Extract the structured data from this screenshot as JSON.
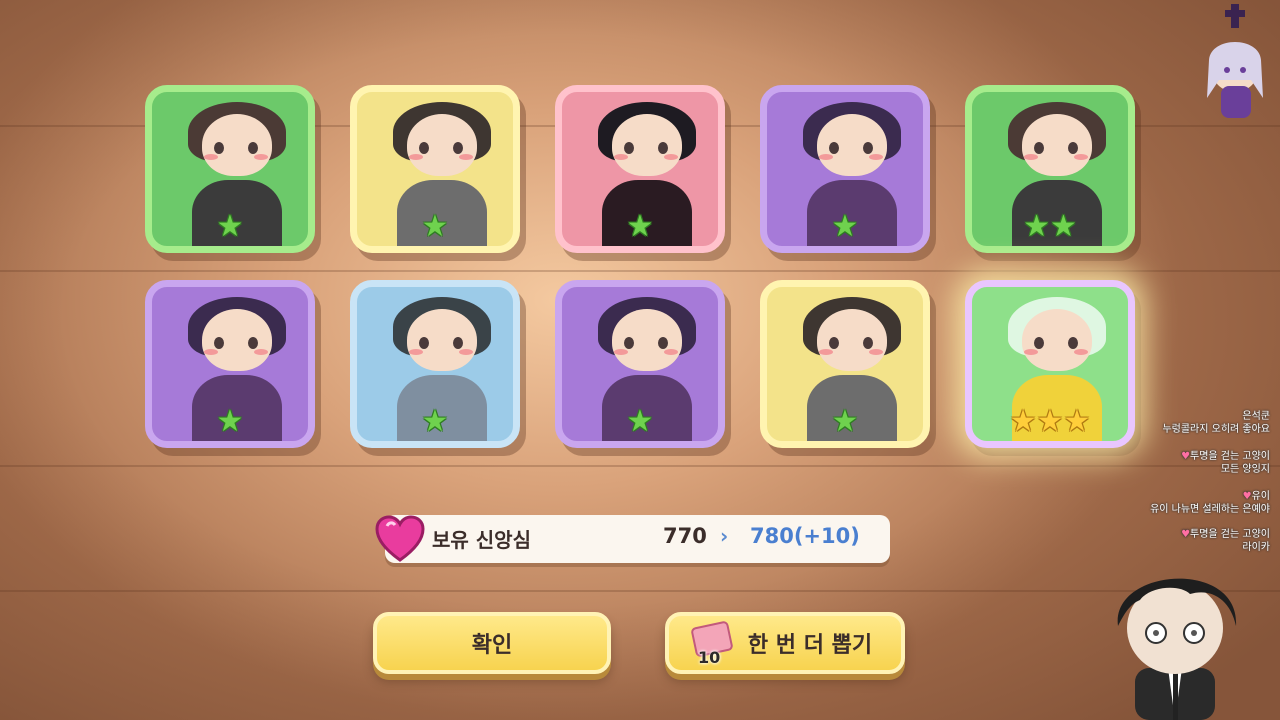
{
  "characters": [
    {
      "color": "green",
      "stars": 1
    },
    {
      "color": "yellow",
      "stars": 1
    },
    {
      "color": "pink",
      "stars": 1
    },
    {
      "color": "purple",
      "stars": 1
    },
    {
      "color": "green",
      "stars": 2
    },
    {
      "color": "purple",
      "stars": 1
    },
    {
      "color": "blue",
      "stars": 1
    },
    {
      "color": "purple",
      "stars": 1
    },
    {
      "color": "yellow",
      "stars": 1
    },
    {
      "color": "rainbow",
      "stars": 3
    }
  ],
  "faith": {
    "label": "보유 신앙심",
    "from": "770",
    "arrow": "›",
    "to": "780(+10)"
  },
  "buttons": {
    "confirm": "확인",
    "draw_again": "한 번 더 뽑기",
    "ticket_count": "10"
  },
  "chat": [
    {
      "user": "은석쿤",
      "text": "누렁콜라지 오히려 좋아요"
    },
    {
      "user": "투명을 걷는 고양이",
      "text": "모든 양잉지"
    },
    {
      "user": "유이",
      "text": "유이 나뉴면 설레하는 은예야"
    },
    {
      "user": "투명을 걷는 고양이",
      "text": "라이카"
    }
  ],
  "icons": {
    "heart": "faith-heart-icon",
    "ticket": "draw-ticket-icon",
    "star": "star-icon"
  }
}
